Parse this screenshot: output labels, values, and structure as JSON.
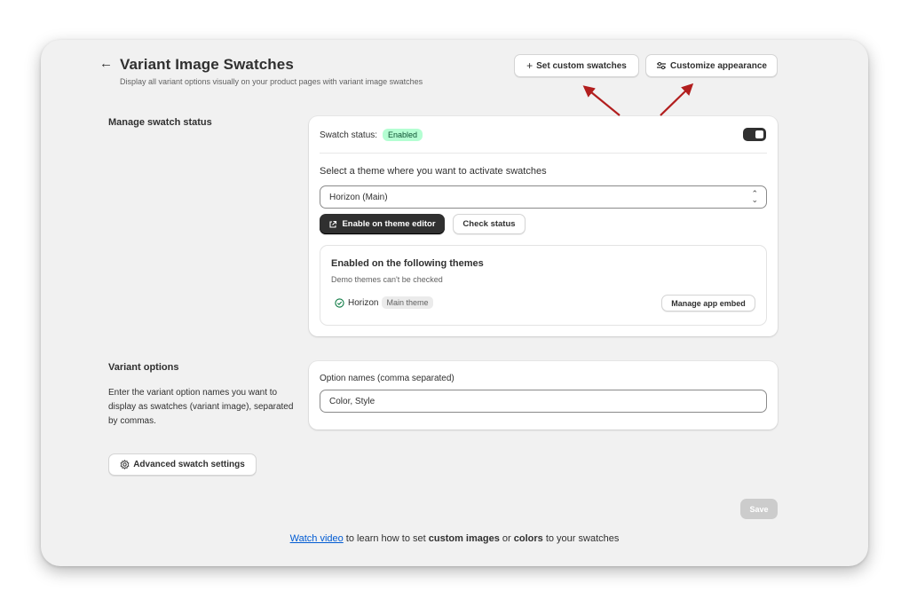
{
  "header": {
    "back_icon": "arrow-left-icon",
    "title": "Variant Image Swatches",
    "subtitle": "Display all variant options visually on your product pages with variant image swatches",
    "set_custom_swatches": "Set custom swatches",
    "customize_appearance": "Customize appearance"
  },
  "manage_status": {
    "section_title": "Manage swatch status",
    "swatch_status_label": "Swatch status:",
    "swatch_status_badge": "Enabled",
    "toggle_on": true,
    "theme_prompt": "Select a theme where you want to activate swatches",
    "theme_selected": "Horizon (Main)",
    "enable_button": "Enable on theme editor",
    "check_button": "Check status",
    "enabled_title": "Enabled on the following themes",
    "enabled_note": "Demo themes can't be checked",
    "theme_name": "Horizon",
    "theme_tag": "Main theme",
    "manage_button": "Manage app embed"
  },
  "variant_options": {
    "section_title": "Variant options",
    "section_desc": "Enter the variant option names you want to display as swatches (variant image), separated by commas.",
    "field_label": "Option names (comma separated)",
    "field_value": "Color, Style"
  },
  "advanced_button": "Advanced swatch settings",
  "save_button": "Save",
  "footer": {
    "link": "Watch video",
    "text1": " to learn how to set ",
    "bold1": "custom images",
    "text2": " or ",
    "bold2": "colors",
    "text3": " to your swatches"
  },
  "colors": {
    "accent_dark": "#303030",
    "badge_green": "#b4fed2",
    "link_blue": "#005bd3",
    "annotation_arrow": "#b21e1e"
  }
}
